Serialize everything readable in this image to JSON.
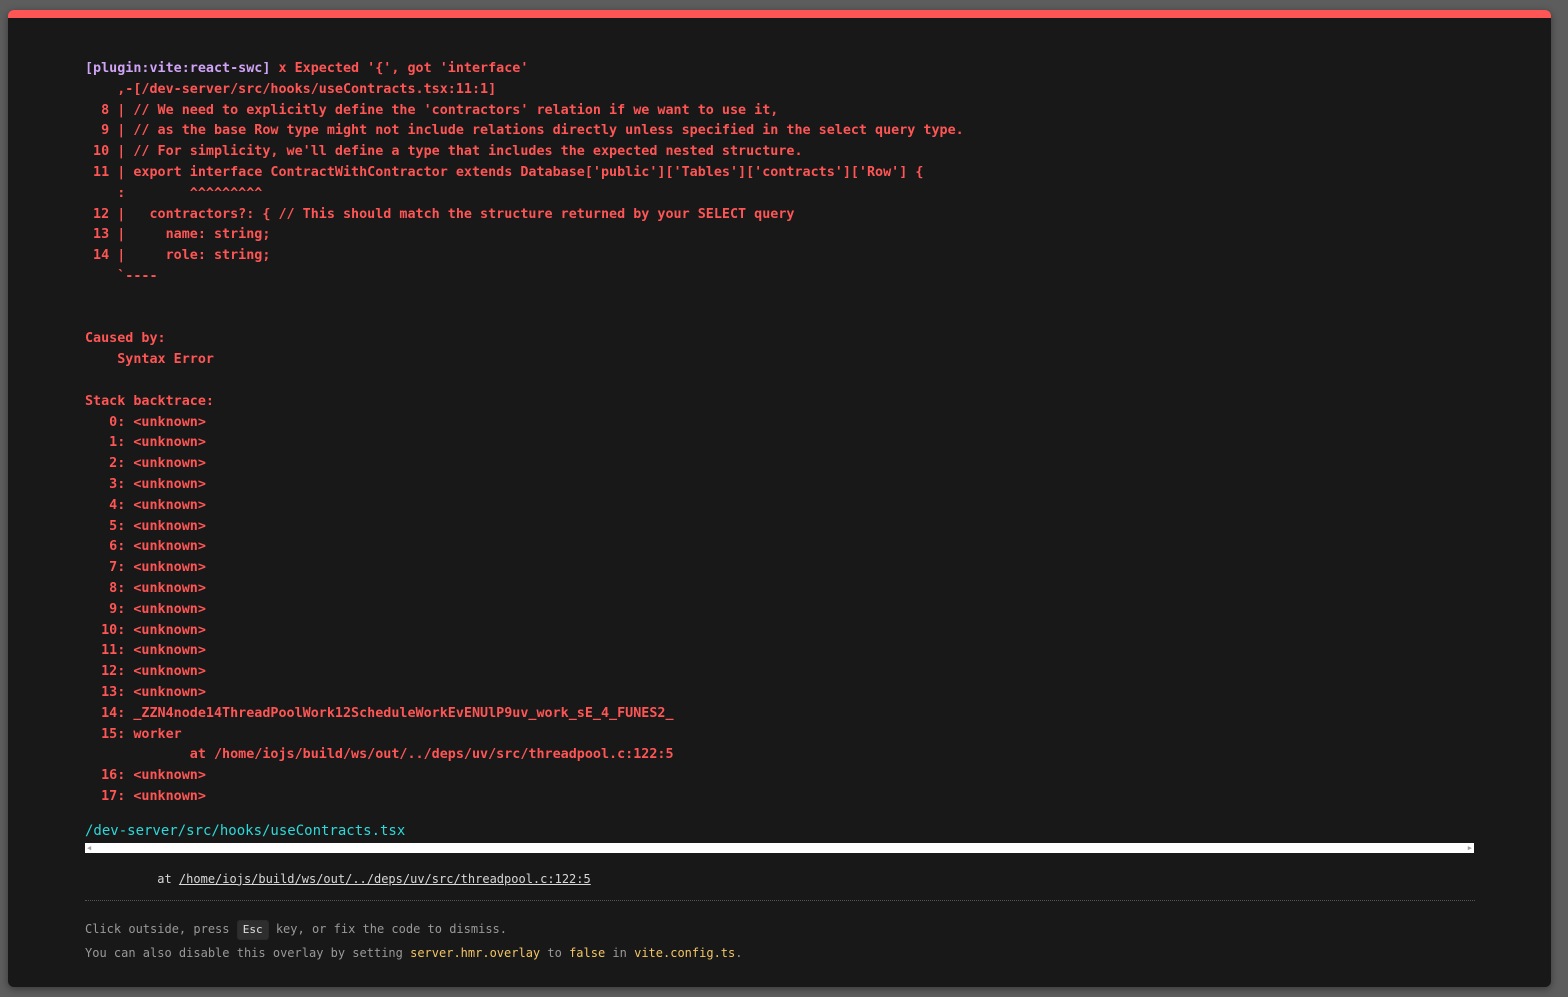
{
  "error": {
    "plugin": "[plugin:vite:react-swc]",
    "message": " x Expected '{', got 'interface'",
    "lines": [
      "    ,-[/dev-server/src/hooks/useContracts.tsx:11:1]",
      "  8 | // We need to explicitly define the 'contractors' relation if we want to use it,",
      "  9 | // as the base Row type might not include relations directly unless specified in the select query type.",
      " 10 | // For simplicity, we'll define a type that includes the expected nested structure.",
      " 11 | export interface ContractWithContractor extends Database['public']['Tables']['contracts']['Row'] {",
      "    :        ^^^^^^^^^",
      " 12 |   contractors?: { // This should match the structure returned by your SELECT query",
      " 13 |     name: string;",
      " 14 |     role: string;",
      "    `----"
    ],
    "caused_by_label": "Caused by:",
    "caused_by": "    Syntax Error",
    "stack_label": "Stack backtrace:",
    "stack": [
      "   0: <unknown>",
      "   1: <unknown>",
      "   2: <unknown>",
      "   3: <unknown>",
      "   4: <unknown>",
      "   5: <unknown>",
      "   6: <unknown>",
      "   7: <unknown>",
      "   8: <unknown>",
      "   9: <unknown>",
      "  10: <unknown>",
      "  11: <unknown>",
      "  12: <unknown>",
      "  13: <unknown>",
      "  14: _ZZN4node14ThreadPoolWork12ScheduleWorkEvENUlP9uv_work_sE_4_FUNES2_",
      "  15: worker",
      "             at /home/iojs/build/ws/out/../deps/uv/src/threadpool.c:122:5",
      "  16: <unknown>",
      "  17: <unknown>"
    ]
  },
  "file": "/dev-server/src/hooks/useContracts.tsx",
  "frame": {
    "prefix": "          at ",
    "path": "/home/iojs/build/ws/out/../deps/uv/src/threadpool.c:122:5"
  },
  "tip": {
    "line1_before": "Click outside, press ",
    "key": "Esc",
    "line1_after": " key, or fix the code to dismiss.",
    "line2_before": "You can also disable this overlay by setting ",
    "setting": "server.hmr.overlay",
    "to": " to ",
    "value": "false",
    "in": " in ",
    "config_file": "vite.config.ts",
    "period": "."
  },
  "colors": {
    "error_red": "#ff5555",
    "plugin_purple": "#cfa3f6",
    "file_cyan": "#2dd9da",
    "code_yellow": "#f3c565",
    "background": "#181818"
  }
}
